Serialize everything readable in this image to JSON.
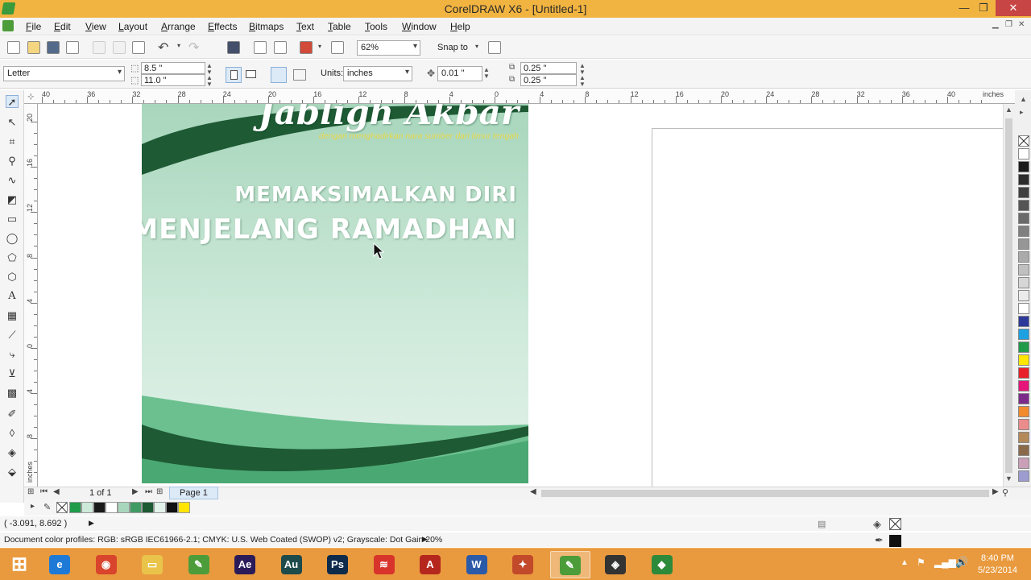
{
  "window": {
    "title": "CorelDRAW X6 - [Untitled-1]",
    "minimize": "—",
    "restore": "❐",
    "close": "✕"
  },
  "menu": [
    "File",
    "Edit",
    "View",
    "Layout",
    "Arrange",
    "Effects",
    "Bitmaps",
    "Text",
    "Table",
    "Tools",
    "Window",
    "Help"
  ],
  "toolbar": {
    "zoom": "62%",
    "snap_to": "Snap to"
  },
  "property_bar": {
    "page_size": "Letter",
    "width": "8.5 \"",
    "height": "11.0 \"",
    "units_label": "Units:",
    "units_value": "inches",
    "nudge": "0.01 \"",
    "dup_x": "0.25 \"",
    "dup_y": "0.25 \""
  },
  "ruler_h": [
    "40",
    "36",
    "32",
    "28",
    "24",
    "20",
    "16",
    "12",
    "8",
    "4",
    "0",
    "4",
    "8",
    "12",
    "16",
    "20",
    "24",
    "28",
    "32",
    "36",
    "40"
  ],
  "ruler_h_unit": "inches",
  "ruler_v": [
    "20",
    "16",
    "12",
    "8",
    "4",
    "0",
    "4",
    "8"
  ],
  "ruler_v_unit": "inches",
  "design": {
    "script_title": "Jabligh Akbar",
    "subline": "dengan menghadirkan nara sumber dari timur tengah",
    "headline_1": "MEMAKSIMALKAN DIRI",
    "headline_2": "MENJELANG RAMADHAN",
    "colors": {
      "dark_green": "#1e5a34",
      "mid_green": "#3f9a64",
      "light_green": "#a8d6bc"
    }
  },
  "pagebar": {
    "counter": "1 of 1",
    "page_tab": "Page 1"
  },
  "status": {
    "coords": "( -3.091, 8.692 )",
    "color_profiles": "Document color profiles: RGB: sRGB IEC61966-2.1; CMYK: U.S. Web Coated (SWOP) v2; Grayscale: Dot Gain 20%"
  },
  "palette_colors": [
    "#ffffff",
    "#1a1a1a",
    "#2d2d2d",
    "#404040",
    "#555555",
    "#6a6a6a",
    "#808080",
    "#969696",
    "#ababab",
    "#c0c0c0",
    "#d6d6d6",
    "#ebebeb",
    "#ffffff",
    "#2d3a9a",
    "#1da1e2",
    "#1f9b4a",
    "#ffe500",
    "#e8202a",
    "#e5157a",
    "#7d2b8b",
    "#f28a2e",
    "#ea8c8c",
    "#b48a5a",
    "#8a6a4a",
    "#caa0b8",
    "#9c9cd0"
  ],
  "doc_palette": [
    "#1f9b4a",
    "#cde9d9",
    "#1a1a1a",
    "#ffffff",
    "#a8d6bc",
    "#3f9a64",
    "#1e5a34",
    "#e3f2ea",
    "#111111",
    "#ffe500"
  ],
  "taskbar": {
    "apps": [
      {
        "name": "windows-start",
        "glyph": "⊞",
        "color": "#ffffff"
      },
      {
        "name": "internet-explorer",
        "glyph": "e",
        "color": "#1e7ad6"
      },
      {
        "name": "chrome",
        "glyph": "◉",
        "color": "#d9442c"
      },
      {
        "name": "file-explorer",
        "glyph": "▭",
        "color": "#e9c34a"
      },
      {
        "name": "coreldraw",
        "glyph": "✎",
        "color": "#4d9c3a"
      },
      {
        "name": "after-effects",
        "glyph": "Ae",
        "color": "#2b1c59"
      },
      {
        "name": "audition",
        "glyph": "Au",
        "color": "#1d4a4a"
      },
      {
        "name": "photoshop",
        "glyph": "Ps",
        "color": "#0f2b4c"
      },
      {
        "name": "app-red",
        "glyph": "≋",
        "color": "#d8342c"
      },
      {
        "name": "acrobat",
        "glyph": "A",
        "color": "#b5271d"
      },
      {
        "name": "word",
        "glyph": "W",
        "color": "#2b5aa8"
      },
      {
        "name": "app-paint",
        "glyph": "✦",
        "color": "#c24a2a"
      },
      {
        "name": "coreldraw-active",
        "glyph": "✎",
        "color": "#4d9c3a"
      },
      {
        "name": "app-dark",
        "glyph": "◈",
        "color": "#333333"
      },
      {
        "name": "app-green",
        "glyph": "◆",
        "color": "#2d8a3a"
      }
    ],
    "time": "8:40 PM",
    "date": "5/23/2014"
  }
}
